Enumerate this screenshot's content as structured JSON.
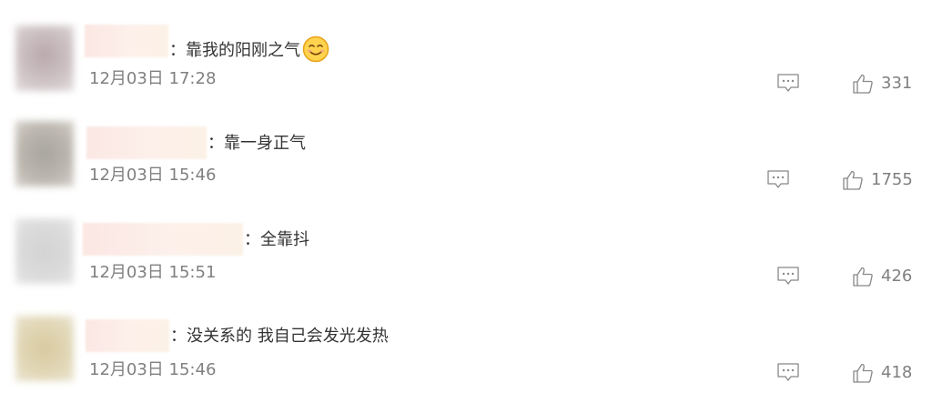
{
  "comments": [
    {
      "text": "：靠我的阳刚之气",
      "has_emoji": true,
      "emoji_icon": "smiling-face-icon",
      "time": "12月03日 17:28",
      "likes": "331"
    },
    {
      "text": "：靠一身正气",
      "time": "12月03日 15:46",
      "likes": "1755"
    },
    {
      "text": "：全靠抖",
      "time": "12月03日 15:51",
      "likes": "426"
    },
    {
      "text": "：没关系的 我自己会发光发热",
      "time": "12月03日 15:46",
      "likes": "418"
    }
  ],
  "icons": {
    "reply": "comment-reply-icon",
    "like": "thumbs-up-icon"
  },
  "colors": {
    "text": "#333333",
    "meta": "#808080",
    "icon": "#888888"
  }
}
